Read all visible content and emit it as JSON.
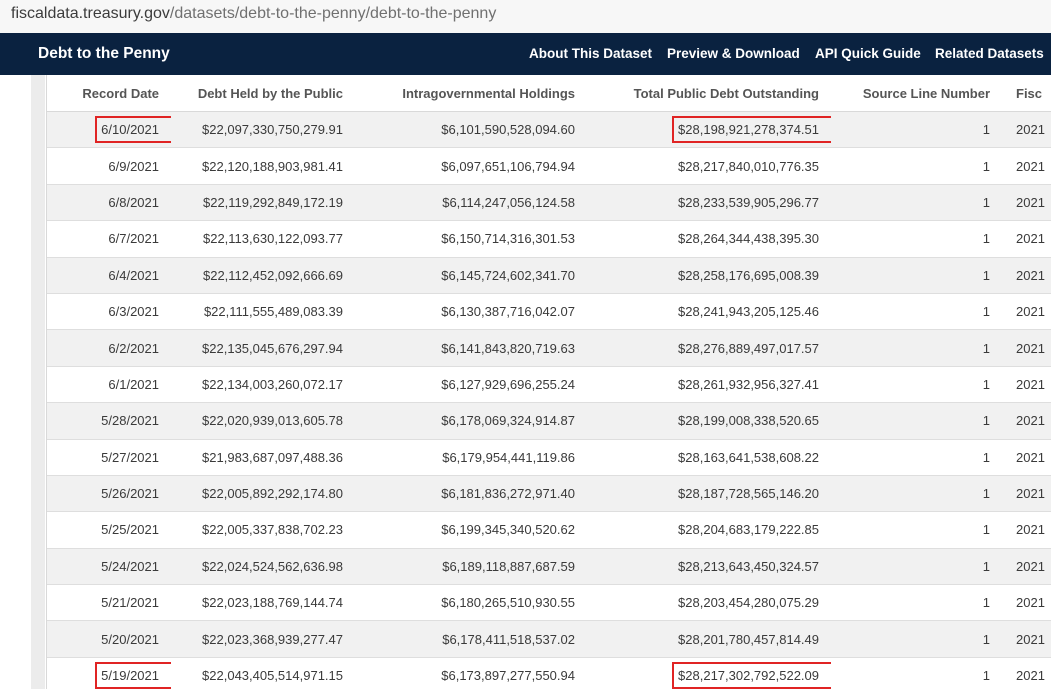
{
  "url": {
    "host": "fiscaldata.treasury.gov",
    "path": "/datasets/debt-to-the-penny/debt-to-the-penny"
  },
  "nav": {
    "title": "Debt to the Penny",
    "links": [
      "About This Dataset",
      "Preview & Download",
      "API Quick Guide",
      "Related Datasets"
    ]
  },
  "table": {
    "columns": [
      "Record Date",
      "Debt Held by the Public",
      "Intragovernmental Holdings",
      "Total Public Debt Outstanding",
      "Source Line Number",
      "Fisc"
    ],
    "rows": [
      [
        "6/10/2021",
        "$22,097,330,750,279.91",
        "$6,101,590,528,094.60",
        "$28,198,921,278,374.51",
        "1",
        "2021"
      ],
      [
        "6/9/2021",
        "$22,120,188,903,981.41",
        "$6,097,651,106,794.94",
        "$28,217,840,010,776.35",
        "1",
        "2021"
      ],
      [
        "6/8/2021",
        "$22,119,292,849,172.19",
        "$6,114,247,056,124.58",
        "$28,233,539,905,296.77",
        "1",
        "2021"
      ],
      [
        "6/7/2021",
        "$22,113,630,122,093.77",
        "$6,150,714,316,301.53",
        "$28,264,344,438,395.30",
        "1",
        "2021"
      ],
      [
        "6/4/2021",
        "$22,112,452,092,666.69",
        "$6,145,724,602,341.70",
        "$28,258,176,695,008.39",
        "1",
        "2021"
      ],
      [
        "6/3/2021",
        "$22,111,555,489,083.39",
        "$6,130,387,716,042.07",
        "$28,241,943,205,125.46",
        "1",
        "2021"
      ],
      [
        "6/2/2021",
        "$22,135,045,676,297.94",
        "$6,141,843,820,719.63",
        "$28,276,889,497,017.57",
        "1",
        "2021"
      ],
      [
        "6/1/2021",
        "$22,134,003,260,072.17",
        "$6,127,929,696,255.24",
        "$28,261,932,956,327.41",
        "1",
        "2021"
      ],
      [
        "5/28/2021",
        "$22,020,939,013,605.78",
        "$6,178,069,324,914.87",
        "$28,199,008,338,520.65",
        "1",
        "2021"
      ],
      [
        "5/27/2021",
        "$21,983,687,097,488.36",
        "$6,179,954,441,119.86",
        "$28,163,641,538,608.22",
        "1",
        "2021"
      ],
      [
        "5/26/2021",
        "$22,005,892,292,174.80",
        "$6,181,836,272,971.40",
        "$28,187,728,565,146.20",
        "1",
        "2021"
      ],
      [
        "5/25/2021",
        "$22,005,337,838,702.23",
        "$6,199,345,340,520.62",
        "$28,204,683,179,222.85",
        "1",
        "2021"
      ],
      [
        "5/24/2021",
        "$22,024,524,562,636.98",
        "$6,189,118,887,687.59",
        "$28,213,643,450,324.57",
        "1",
        "2021"
      ],
      [
        "5/21/2021",
        "$22,023,188,769,144.74",
        "$6,180,265,510,930.55",
        "$28,203,454,280,075.29",
        "1",
        "2021"
      ],
      [
        "5/20/2021",
        "$22,023,368,939,277.47",
        "$6,178,411,518,537.02",
        "$28,201,780,457,814.49",
        "1",
        "2021"
      ],
      [
        "5/19/2021",
        "$22,043,405,514,971.15",
        "$6,173,897,277,550.94",
        "$28,217,302,792,522.09",
        "1",
        "2021"
      ]
    ]
  },
  "annotations": {
    "color": "#e02424",
    "highlighted_cells": [
      "6/10/2021",
      "$28,198,921,278,374.51",
      "5/19/2021",
      "$28,217,302,792,522.09"
    ]
  }
}
